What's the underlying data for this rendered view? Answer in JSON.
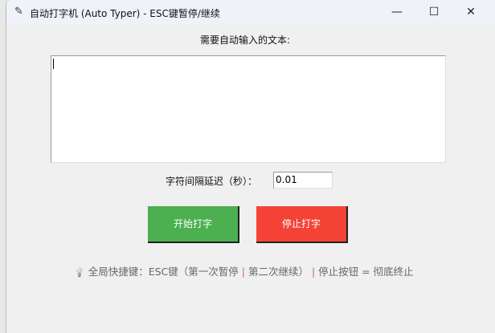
{
  "window": {
    "title": "自动打字机 (Auto Typer) - ESC键暂停/继续",
    "minimize": "—",
    "maximize": "☐",
    "close": "✕"
  },
  "text_label": "需要自动输入的文本:",
  "text_value": "",
  "delay_label": "字符间隔延迟（秒）：",
  "delay_value": "0.01",
  "start_button": "开始打字",
  "stop_button": "停止打字",
  "hint": {
    "icon": "lightbulb-icon",
    "icon_glyph": "💡",
    "part1": "全局快捷键：ESC键（第一次暂停",
    "sep1": "|",
    "part2": "第二次继续）",
    "sep2": "|",
    "part3": "停止按钮 = 彻底终止"
  },
  "colors": {
    "start": "#4caf50",
    "stop": "#f44336"
  }
}
